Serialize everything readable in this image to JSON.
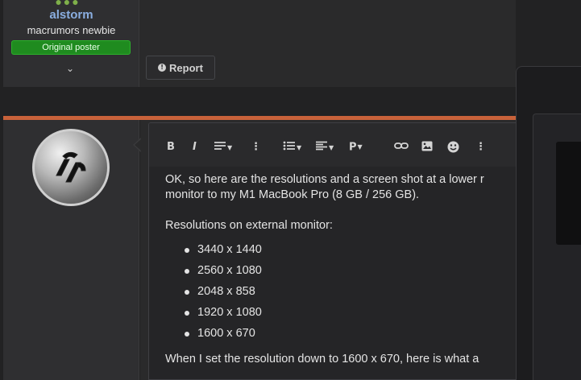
{
  "top_post": {
    "username": "alstorm",
    "user_title": "macrumors newbie",
    "badge": "Original poster",
    "report_label": "Report"
  },
  "toolbar": {
    "bold": "B",
    "italic": "I",
    "more": "⋮",
    "paragraph": "P"
  },
  "message": {
    "intro_line1": "OK, so here are the resolutions and a screen shot at a lower r",
    "intro_line2": "monitor to my M1 MacBook Pro (8 GB / 256 GB).",
    "list_heading": "Resolutions on external monitor:",
    "resolutions": [
      "3440 x 1440",
      "2560 x 1080",
      "2048 x 858",
      "1920 x 1080",
      "1600 x 670"
    ],
    "closing": "When I set the resolution down to 1600 x 670, here is what a"
  },
  "colors": {
    "accent_divider": "#c8623a",
    "username": "#8aaee0",
    "badge_bg": "#1f8b1f"
  }
}
